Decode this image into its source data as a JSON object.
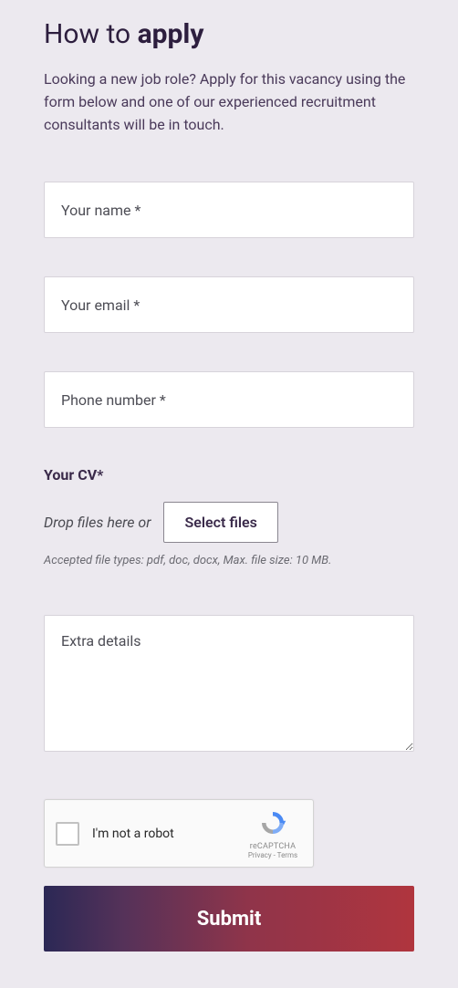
{
  "heading": {
    "pre": "How to ",
    "bold": "apply"
  },
  "intro": "Looking a new job role? Apply for this vacancy using the form below and one of our experienced recruitment consultants will be in touch.",
  "fields": {
    "name_placeholder": "Your name *",
    "email_placeholder": "Your email *",
    "phone_placeholder": "Phone number *",
    "extra_placeholder": "Extra details"
  },
  "cv": {
    "label": "Your CV*",
    "drop_text": "Drop files here or",
    "button": "Select files",
    "accepted": "Accepted file types: pdf, doc, docx, Max. file size: 10 MB."
  },
  "recaptcha": {
    "label": "I'm not a robot",
    "brand": "reCAPTCHA",
    "links": "Privacy - Terms"
  },
  "submit": "Submit"
}
